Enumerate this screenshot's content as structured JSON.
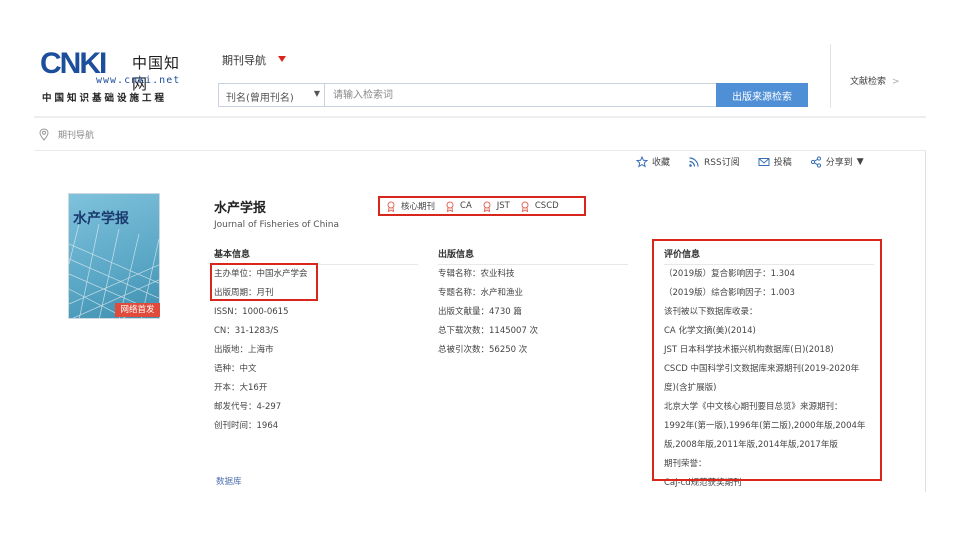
{
  "logo": {
    "brand": "CNKI",
    "brand_cn": "中国知网",
    "url": "www.cnki.net",
    "subtitle": "中国知识基础设施工程"
  },
  "nav": {
    "title": "期刊导航"
  },
  "search": {
    "select_value": "刊名(曾用刊名)",
    "placeholder": "请输入检索词",
    "button_label": "出版来源检索"
  },
  "doc_search": {
    "label": "文献检索",
    "chevron": ">"
  },
  "breadcrumb": {
    "label": "期刊导航"
  },
  "actions": [
    {
      "label": "收藏",
      "icon": "star-icon"
    },
    {
      "label": "RSS订阅",
      "icon": "rss-icon"
    },
    {
      "label": "投稿",
      "icon": "mail-icon"
    },
    {
      "label": "分享到",
      "icon": "share-icon"
    }
  ],
  "cover": {
    "title": "水产学报",
    "badge": "网络首发"
  },
  "journal": {
    "title": "水产学报",
    "title_en": "Journal of Fisheries of China"
  },
  "tags": [
    "核心期刊",
    "CA",
    "JST",
    "CSCD"
  ],
  "basic": {
    "heading": "基本信息",
    "rows": [
      "主办单位：中国水产学会",
      "出版周期：月刊",
      "ISSN：1000-0615",
      "CN：31-1283/S",
      "出版地：上海市",
      "语种：中文",
      "开本：大16开",
      "邮发代号：4-297",
      "创刊时间：1964"
    ]
  },
  "publishing": {
    "heading": "出版信息",
    "rows": [
      "专辑名称：农业科技",
      "专题名称：水产和渔业",
      "出版文献量：4730 篇",
      "总下载次数：1145007 次",
      "总被引次数：56250 次"
    ]
  },
  "evaluation": {
    "heading": "评价信息",
    "rows": [
      "（2019版）复合影响因子：1.304",
      "（2019版）综合影响因子：1.003",
      "该刊被以下数据库收录：",
      "CA 化学文摘(美)(2014)",
      "JST 日本科学技术振兴机构数据库(日)(2018)",
      "CSCD 中国科学引文数据库来源期刊(2019-2020年",
      "度)(含扩展版)",
      "北京大学《中文核心期刊要目总览》来源期刊：",
      "1992年(第一版),1996年(第二版),2000年版,2004年",
      "版,2008年版,2011年版,2014年版,2017年版",
      "期刊荣誉：",
      "Caj-cd规范获奖期刊"
    ]
  },
  "more_link": "数据库"
}
